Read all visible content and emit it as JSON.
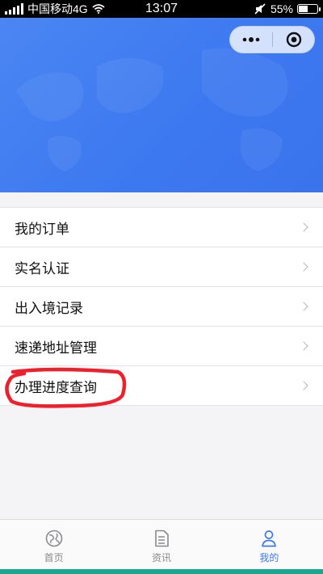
{
  "status_bar": {
    "carrier": "中国移动4G",
    "time": "13:07",
    "battery": "55%",
    "battery_level": 0.55,
    "icons": [
      "signal-icon",
      "wifi-icon",
      "mute-icon",
      "battery-icon"
    ]
  },
  "capsule": {
    "more_icon": "more-dots-icon",
    "close_icon": "close-target-icon"
  },
  "menu": {
    "items": [
      {
        "label": "我的订单"
      },
      {
        "label": "实名认证"
      },
      {
        "label": "出入境记录"
      },
      {
        "label": "速递地址管理"
      },
      {
        "label": "办理进度查询"
      }
    ],
    "highlighted_item": "办理进度查询",
    "highlight_color": "#ef1f2b"
  },
  "tabbar": {
    "tabs": [
      {
        "label": "首页",
        "icon": "globe-icon",
        "active": false
      },
      {
        "label": "资讯",
        "icon": "document-icon",
        "active": false
      },
      {
        "label": "我的",
        "icon": "user-icon",
        "active": true
      }
    ]
  },
  "colors": {
    "banner": "#3c78f0",
    "accent": "#3c78f0",
    "tab_inactive": "#8a8a8f"
  }
}
